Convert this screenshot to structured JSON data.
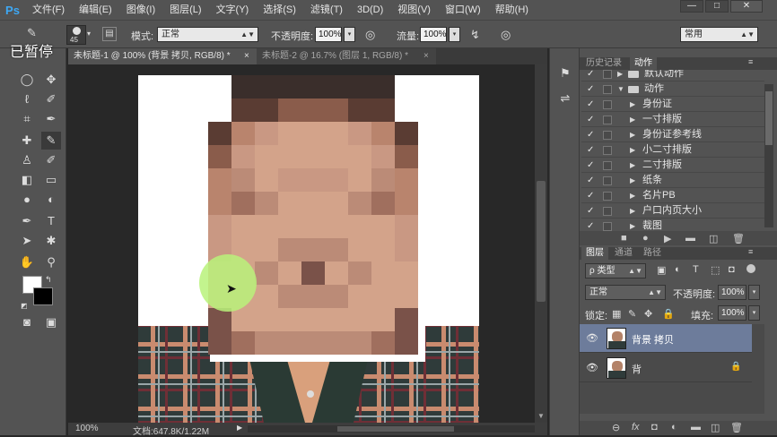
{
  "app": {
    "logo": "Ps",
    "paused_overlay": "已暂停"
  },
  "menu": [
    "文件(F)",
    "编辑(E)",
    "图像(I)",
    "图层(L)",
    "文字(Y)",
    "选择(S)",
    "滤镜(T)",
    "3D(D)",
    "视图(V)",
    "窗口(W)",
    "帮助(H)"
  ],
  "window_controls": {
    "minimize": "—",
    "restore": "□",
    "close": "✕"
  },
  "options": {
    "brush_size": "45",
    "mode_label": "模式:",
    "mode_value": "正常",
    "opacity_label": "不透明度:",
    "opacity_value": "100%",
    "flow_label": "流量:",
    "flow_value": "100%",
    "workspace": "常用"
  },
  "doc_tabs": [
    {
      "label": "未标题-1 @ 100% (背景 拷贝, RGB/8) *",
      "active": true,
      "close": "×"
    },
    {
      "label": "未标题-2 @ 16.7% (图层 1, RGB/8) *",
      "active": false,
      "close": "×"
    }
  ],
  "status": {
    "zoom": "100%",
    "doc_size": "文档:647.8K/1.22M"
  },
  "history_panel": {
    "tabs": [
      "历史记录",
      "动作"
    ],
    "active_tab": "动作",
    "items": [
      {
        "name": "默认动作",
        "type": "set",
        "expanded": false
      },
      {
        "name": "动作",
        "type": "set",
        "expanded": true
      },
      {
        "name": "身份证",
        "type": "action"
      },
      {
        "name": "一寸排版",
        "type": "action"
      },
      {
        "name": "身份证参考线",
        "type": "action"
      },
      {
        "name": "小二寸排版",
        "type": "action"
      },
      {
        "name": "二寸排版",
        "type": "action"
      },
      {
        "name": "纸条",
        "type": "action"
      },
      {
        "name": "名片PB",
        "type": "action"
      },
      {
        "name": "户口内页大小",
        "type": "action"
      },
      {
        "name": "裁图",
        "type": "action"
      }
    ],
    "footer_icons": [
      "stop-icon",
      "record-icon",
      "play-icon",
      "folder-icon",
      "new-icon",
      "delete-icon"
    ]
  },
  "layers_panel": {
    "tabs": [
      "图层",
      "通道",
      "路径"
    ],
    "active_tab": "图层",
    "filter_label": "ρ 类型",
    "blend_mode": "正常",
    "opacity_label": "不透明度:",
    "opacity_value": "100%",
    "lock_label": "锁定:",
    "fill_label": "填充:",
    "fill_value": "100%",
    "layers": [
      {
        "name": "背景 拷贝",
        "selected": true
      },
      {
        "name": "背",
        "selected": false,
        "locked": true
      }
    ],
    "footer_icons": [
      "link-icon",
      "fx-icon",
      "mask-icon",
      "adjustment-icon",
      "group-icon",
      "new-layer-icon",
      "delete-icon"
    ]
  },
  "colors": {
    "accent": "#3ea8f4",
    "selected_layer": "#6d7c9b",
    "brush_cursor": "#b8f27a"
  }
}
